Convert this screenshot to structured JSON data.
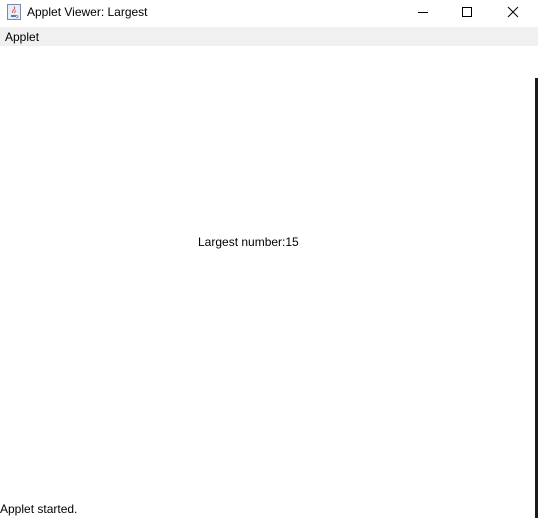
{
  "window": {
    "title": "Applet Viewer: Largest",
    "icon": "java-cup-icon"
  },
  "menubar": {
    "items": [
      {
        "label": "Applet"
      }
    ]
  },
  "content": {
    "message": "Largest number:15"
  },
  "status": {
    "text": "Applet started."
  },
  "colors": {
    "titlebar_bg": "#ffffff",
    "menubar_bg": "#f0f0f0",
    "content_bg": "#ffffff",
    "text": "#000000"
  }
}
